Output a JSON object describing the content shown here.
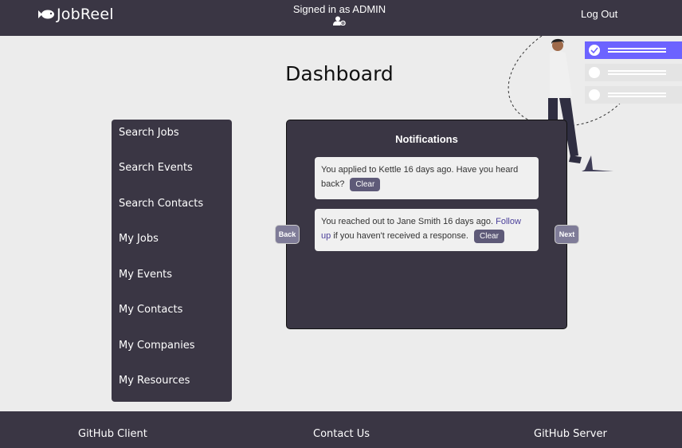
{
  "header": {
    "brand": "JobReel",
    "signed_in": "Signed in as ADMIN",
    "logout": "Log Out"
  },
  "page": {
    "title": "Dashboard"
  },
  "sidebar": {
    "items": [
      {
        "label": "Search Jobs"
      },
      {
        "label": "Search Events"
      },
      {
        "label": "Search Contacts"
      },
      {
        "label": "My Jobs"
      },
      {
        "label": "My Events"
      },
      {
        "label": "My Contacts"
      },
      {
        "label": "My Companies"
      },
      {
        "label": "My Resources"
      }
    ]
  },
  "notifications": {
    "title": "Notifications",
    "items": [
      {
        "text": "You applied to Kettle 16 days ago. Have you heard back?",
        "clear": "Clear"
      },
      {
        "text_before": "You reached out to Jane Smith 16 days ago.",
        "link": "Follow up",
        "text_after": "if you haven't received a response.",
        "clear": "Clear"
      }
    ],
    "back": "Back",
    "next": "Next"
  },
  "footer": {
    "github_client": "GitHub Client",
    "contact_us": "Contact Us",
    "github_server": "GitHub Server"
  },
  "colors": {
    "dark": "#3a3644",
    "accent": "#6c63ff",
    "button": "#5e5a78"
  },
  "icons": {
    "brand": "fish-icon",
    "admin": "user-gear-icon"
  }
}
